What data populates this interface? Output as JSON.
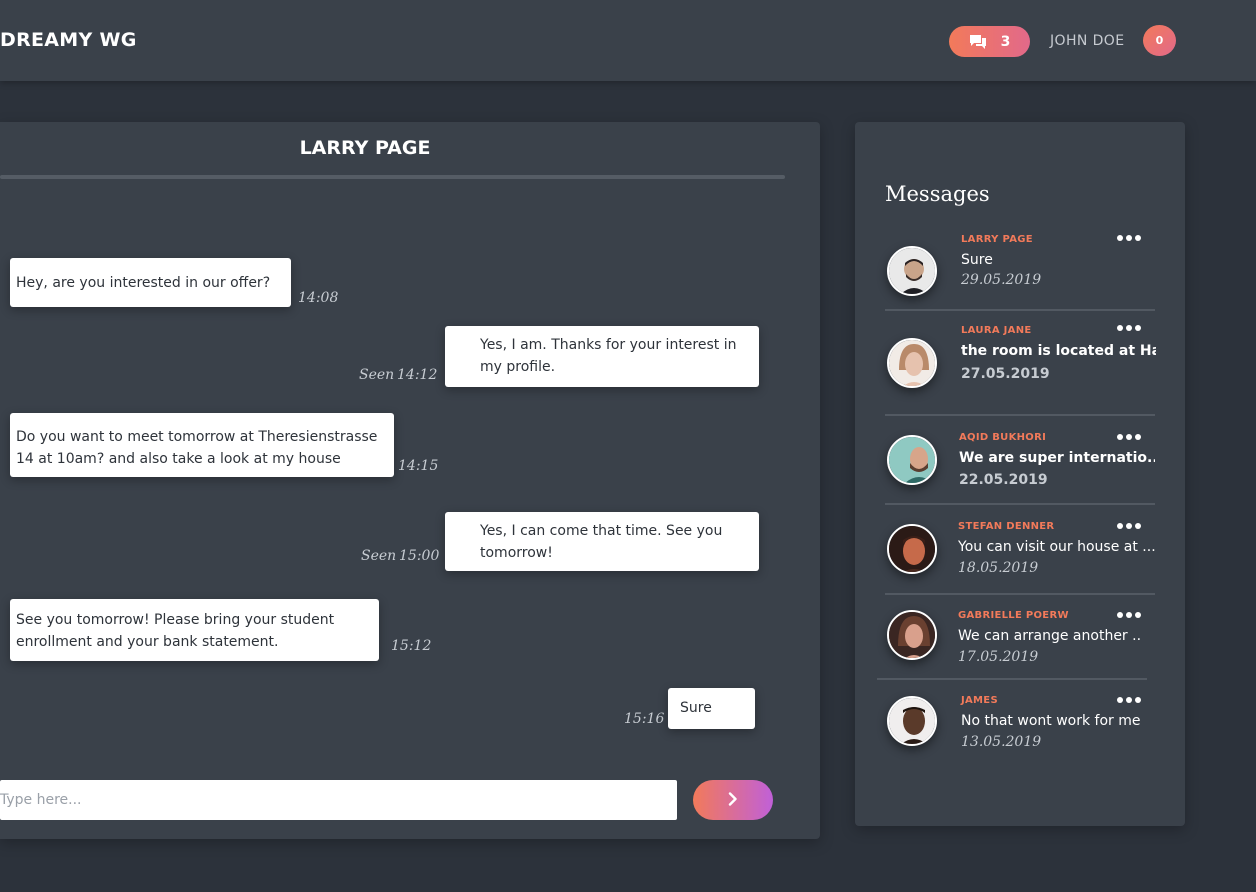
{
  "header": {
    "brand": "DREAMY WG",
    "messages_count": "3",
    "username": "JOHN DOE",
    "notifications_count": "0"
  },
  "chat": {
    "title": "LARRY PAGE",
    "messages": [
      {
        "direction": "in",
        "text": "Hey, are you interested in our offer?",
        "time": "14:08",
        "status": ""
      },
      {
        "direction": "out",
        "text": "Yes, I am. Thanks for your interest in my profile.",
        "time": "14:12",
        "status": "Seen"
      },
      {
        "direction": "in",
        "text": "Do you want to meet tomorrow at Theresienstrasse 14 at 10am? and also take a look at my house",
        "time": "14:15",
        "status": ""
      },
      {
        "direction": "out",
        "text": "Yes, I can come that time. See you tomorrow!",
        "time": "15:00",
        "status": "Seen"
      },
      {
        "direction": "in",
        "text": "See you tomorrow! Please bring your student enrollment and your bank statement.",
        "time": "15:12",
        "status": ""
      },
      {
        "direction": "out",
        "text": "Sure",
        "time": "15:16",
        "status": ""
      }
    ],
    "composer_placeholder": "Type here..."
  },
  "inbox": {
    "title": "Messages",
    "conversations": [
      {
        "name": "LARRY PAGE",
        "preview": "Sure",
        "date": "29.05.2019",
        "unread": false,
        "avatar_color": "#c9a48a"
      },
      {
        "name": "LAURA JANE",
        "preview": "the room is located at Ha..",
        "date": "27.05.2019",
        "unread": true,
        "avatar_color": "#e6c2ae"
      },
      {
        "name": "AQID BUKHORI",
        "preview": "We are super internatio..",
        "date": "22.05.2019",
        "unread": true,
        "avatar_color": "#8fc9c2"
      },
      {
        "name": "STEFAN DENNER",
        "preview": "You can visit our house at ...",
        "date": "18.05.2019",
        "unread": false,
        "avatar_color": "#b0573d"
      },
      {
        "name": "GABRIELLE POERW",
        "preview": "We can arrange another ..",
        "date": "17.05.2019",
        "unread": false,
        "avatar_color": "#d9a08c"
      },
      {
        "name": "JAMES",
        "preview": "No that wont work for me",
        "date": "13.05.2019",
        "unread": false,
        "avatar_color": "#5a3a2a"
      }
    ]
  },
  "colors": {
    "accent": "#f27a5a",
    "accent_pink": "#e2698a",
    "accent_purple": "#c060d8",
    "panel": "#3a414a",
    "background": "#2c323b"
  },
  "icons": {
    "messages": "chat-bubbles-icon",
    "send": "chevron-right-icon",
    "more": "more-dots-icon"
  }
}
